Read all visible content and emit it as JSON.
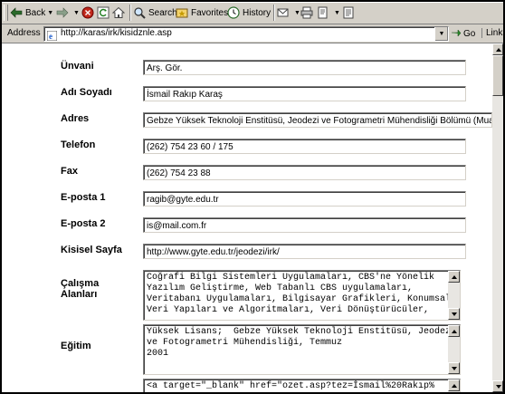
{
  "toolbar": {
    "back": "Back",
    "search": "Search",
    "favorites": "Favorites",
    "history": "History"
  },
  "address": {
    "label": "Address",
    "url": "http://karas/irk/kisidznle.asp",
    "go": "Go",
    "links": "Links"
  },
  "form": {
    "unvani": {
      "label": "Ünvani",
      "value": "Arş. Gör."
    },
    "adi_soyadi": {
      "label": "Adı Soyadı",
      "value": "İsmail Rakıp Karaş"
    },
    "adres": {
      "label": "Adres",
      "value": "Gebze Yüksek Teknoloji Enstitüsü, Jeodezi ve Fotogrametri Mühendisliği Bölümü (Mualli"
    },
    "telefon": {
      "label": "Telefon",
      "value": "(262) 754 23 60 / 175"
    },
    "fax": {
      "label": "Fax",
      "value": "(262) 754 23 88"
    },
    "eposta1": {
      "label": "E-posta 1",
      "value": "ragib@gyte.edu.tr"
    },
    "eposta2": {
      "label": "E-posta 2",
      "value": "is@mail.com.fr"
    },
    "kisisel_sayfa": {
      "label": "Kisisel Sayfa",
      "value": "http://www.gyte.edu.tr/jeodezi/irk/"
    },
    "calisma_alanlari": {
      "label_line1": "Çalışma",
      "label_line2": "Alanları",
      "value": "Coğrafi Bilgi Sistemleri Uygulamaları, CBS'ne Yönelik\nYazılım Geliştirme, Web Tabanlı CBS uygulamaları,\nVeritabanı Uygulamaları, Bilgisayar Grafikleri, Konumsal\nVeri Yapıları ve Algoritmaları, Veri Dönüştürücüler,"
    },
    "egitim": {
      "label": "Eğitim",
      "value": "Yüksek Lisans;  Gebze Yüksek Teknoloji Enstitüsü, Jeodezi\nve Fotogrametri Mühendisliği, Temmuz\n2001"
    },
    "last_textarea": {
      "value": "<a target=\"_blank\" href=\"ozet.asp?tez=İsmail%20Rakıp%"
    }
  }
}
